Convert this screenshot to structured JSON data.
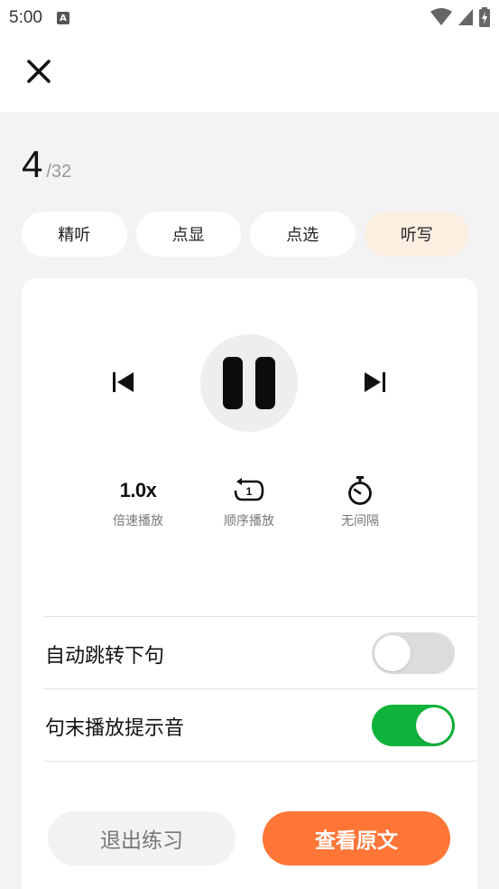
{
  "status_bar": {
    "time": "5:00",
    "notification_icon": "A"
  },
  "header": {
    "close_icon": "close-icon"
  },
  "progress": {
    "current": "4",
    "total": "/32"
  },
  "tabs": [
    {
      "label": "精听",
      "active": false
    },
    {
      "label": "点显",
      "active": false
    },
    {
      "label": "点选",
      "active": false
    },
    {
      "label": "听写",
      "active": true
    }
  ],
  "player": {
    "prev_icon": "skip-previous-icon",
    "play_state_icon": "pause-icon",
    "next_icon": "skip-next-icon"
  },
  "options": {
    "speed_value": "1.0x",
    "speed_label": "倍速播放",
    "order_label": "顺序播放",
    "order_icon_text": "1",
    "interval_label": "无间隔"
  },
  "settings": {
    "auto_next_label": "自动跳转下句",
    "auto_next_enabled": false,
    "end_sound_label": "句末播放提示音",
    "end_sound_enabled": true
  },
  "actions": {
    "exit_label": "退出练习",
    "view_label": "查看原文"
  },
  "colors": {
    "accent": "#ff7637",
    "active_tab_bg": "#fdeee2",
    "toggle_on": "#0fb33b",
    "toggle_off": "#dcdcdc",
    "page_bg": "#f2f3f5"
  }
}
